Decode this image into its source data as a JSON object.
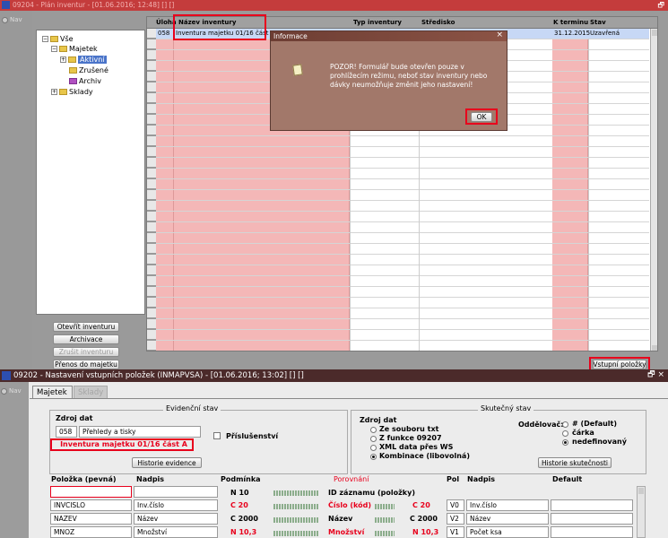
{
  "top_window": {
    "title": "09204 - Plán inventur - [01.06.2016; 12:48] [] []",
    "restore_glyph": "🗗",
    "nav_label": "Nav",
    "tree": [
      {
        "label": "Vše",
        "level": 0,
        "expander": "−"
      },
      {
        "label": "Majetek",
        "level": 1,
        "expander": "−"
      },
      {
        "label": "Aktivní",
        "level": 2,
        "expander": "+",
        "selected": true
      },
      {
        "label": "Zrušené",
        "level": 2,
        "expander": ""
      },
      {
        "label": "Archiv",
        "level": 2,
        "expander": ""
      },
      {
        "label": "Sklady",
        "level": 1,
        "expander": "+"
      }
    ],
    "left_buttons": [
      "Otevřít inventuru",
      "Archivace",
      "Zrušit inventuru",
      "Přenos do majetku"
    ],
    "columns": {
      "uloha": "Úloha",
      "nazev": "Název inventury",
      "typ": "Typ inventury",
      "stredisko": "Středisko",
      "termin": "K terminu",
      "stav": "Stav"
    },
    "row": {
      "uloha": "058",
      "nazev": "Inventura majetku 01/16 část A",
      "termin": "31.12.2015",
      "stav": "Uzavřená"
    },
    "vstupni_button": "Vstupní položky"
  },
  "dialog": {
    "title": "Informace",
    "close": "×",
    "message": "POZOR! Formulář bude otevřen pouze v prohlížecím režimu, neboť stav inventury nebo dávky neumožňuje změnit jeho nastavení!",
    "ok": "OK"
  },
  "bottom_window": {
    "title": "09202 - Nastavení vstupních položek (INMAPVSA) - [01.06.2016; 13:02] [] []",
    "controls": "🗗 ×",
    "nav_label": "Nav",
    "tabs": [
      "Majetek",
      "Sklady"
    ],
    "evidencni": {
      "header": "Evidenční stav",
      "zdroj_label": "Zdroj dat",
      "code": "058",
      "zdroj_value": "Přehledy a tisky",
      "inventura": "Inventura majetku 01/16 část A",
      "prislusenstvi": "Příslušenství",
      "historie_btn": "Historie evidence"
    },
    "skutecny": {
      "header": "Skutečný stav",
      "zdroj_label": "Zdroj dat",
      "options": [
        "Ze souboru txt",
        "Z funkce 09207",
        "XML data přes WS",
        "Kombinace (libovolná)"
      ],
      "oddelovac_label": "Oddělovač:",
      "oddelovac_options": [
        "# (Default)",
        "čárka",
        "nedefinovaný"
      ],
      "historie_btn": "Historie skutečnosti"
    },
    "grid_headers": {
      "polozka": "Položka (pevná)",
      "nadpis": "Nadpis",
      "podminka": "Podmínka",
      "porovnani": "Porovnání",
      "pol": "Pol",
      "nadpis2": "Nadpis",
      "default": "Default"
    },
    "rows": [
      {
        "polozka": "",
        "nadpis": "",
        "podminka": "N 10",
        "porovnani": "ID záznamu (položky)",
        "cond2": "",
        "pol": "",
        "nadpis2": "",
        "red_cond": false
      },
      {
        "polozka": "INVCISLO",
        "nadpis": "Inv.číslo",
        "podminka": "C 20",
        "porovnani": "Číslo (kód)",
        "cond2": "C 20",
        "pol": "V0",
        "nadpis2": "Inv.číslo",
        "red_cond": true
      },
      {
        "polozka": "NAZEV",
        "nadpis": "Název",
        "podminka": "C 2000",
        "porovnani": "Název",
        "cond2": "C 2000",
        "pol": "V2",
        "nadpis2": "Název",
        "red_cond": false
      },
      {
        "polozka": "MNOZ",
        "nadpis": "Množství",
        "podminka": "N 10,3",
        "porovnani": "Množství",
        "cond2": "N 10,3",
        "pol": "V1",
        "nadpis2": "Počet ksa",
        "red_cond": true
      }
    ]
  }
}
